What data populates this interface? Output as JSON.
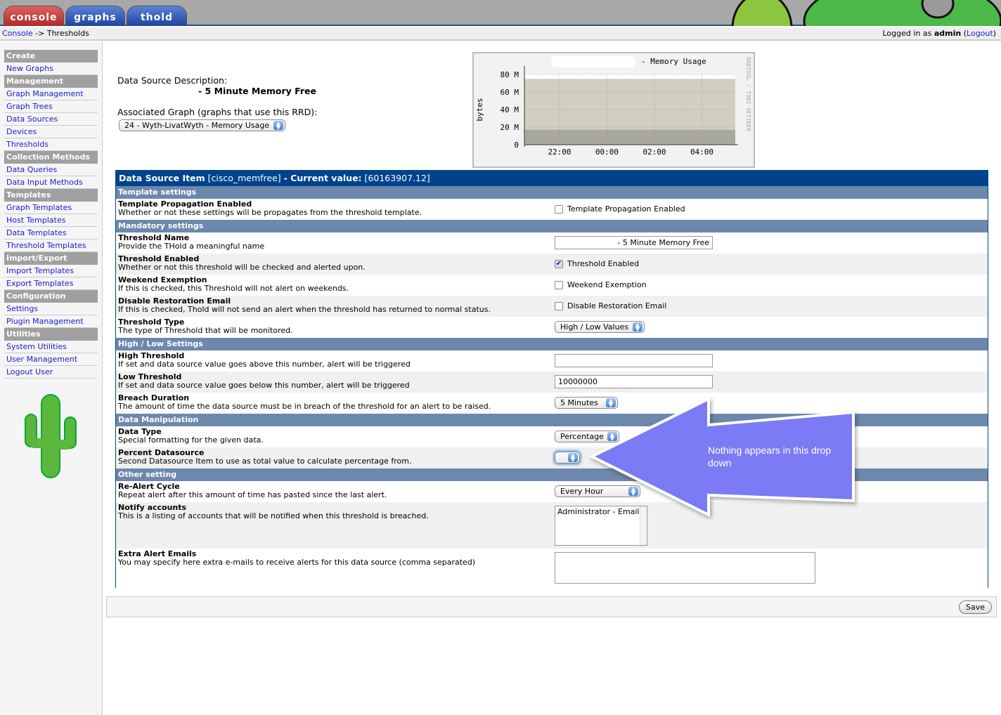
{
  "tabs": [
    {
      "label": "console",
      "color": "#c0393a"
    },
    {
      "label": "graphs",
      "color": "#2b55b0"
    },
    {
      "label": "thold",
      "color": "#2b55b0"
    }
  ],
  "breadcrumb": {
    "root": "Console",
    "sep": "->",
    "current": "Thresholds"
  },
  "login": {
    "prefix": "Logged in as",
    "user": "admin",
    "logout": "Logout"
  },
  "sidebar": [
    {
      "type": "head",
      "label": "Create"
    },
    {
      "type": "item",
      "label": "New Graphs"
    },
    {
      "type": "head",
      "label": "Management"
    },
    {
      "type": "item",
      "label": "Graph Management"
    },
    {
      "type": "item",
      "label": "Graph Trees"
    },
    {
      "type": "item",
      "label": "Data Sources"
    },
    {
      "type": "item",
      "label": "Devices"
    },
    {
      "type": "item",
      "label": "Thresholds"
    },
    {
      "type": "head",
      "label": "Collection Methods"
    },
    {
      "type": "item",
      "label": "Data Queries"
    },
    {
      "type": "item",
      "label": "Data Input Methods"
    },
    {
      "type": "head",
      "label": "Templates"
    },
    {
      "type": "item",
      "label": "Graph Templates"
    },
    {
      "type": "item",
      "label": "Host Templates"
    },
    {
      "type": "item",
      "label": "Data Templates"
    },
    {
      "type": "item",
      "label": "Threshold Templates"
    },
    {
      "type": "head",
      "label": "Import/Export"
    },
    {
      "type": "item",
      "label": "Import Templates"
    },
    {
      "type": "item",
      "label": "Export Templates"
    },
    {
      "type": "head",
      "label": "Configuration"
    },
    {
      "type": "item",
      "label": "Settings"
    },
    {
      "type": "item",
      "label": "Plugin Management"
    },
    {
      "type": "head",
      "label": "Utilities"
    },
    {
      "type": "item",
      "label": "System Utilities"
    },
    {
      "type": "item",
      "label": "User Management"
    },
    {
      "type": "item",
      "label": "Logout User"
    }
  ],
  "ds": {
    "desc_label": "Data Source Description:",
    "desc_value": "- 5 Minute Memory Free",
    "assoc_label": "Associated Graph (graphs that use this RRD):",
    "assoc_value": "24 - Wyth-LivatWyth - Memory Usage"
  },
  "chart_data": {
    "type": "area",
    "title": "- Memory Usage",
    "ylabel": "bytes",
    "watermark": "RRDTOOL / TOBI OETIKER",
    "ylim": [
      0,
      80
    ],
    "yunit": "M",
    "yticks": [
      "0",
      "20 M",
      "40 M",
      "60 M",
      "80 M"
    ],
    "xticks": [
      "22:00",
      "00:00",
      "02:00",
      "04:00"
    ],
    "grid": true,
    "series": [
      {
        "values": [
          17,
          17,
          17,
          17,
          17,
          17
        ],
        "color": "#a8a89c"
      },
      {
        "values": [
          75,
          75,
          75,
          75,
          75,
          75
        ],
        "color": "#cfcfc2"
      }
    ]
  },
  "form": {
    "header": {
      "bold1": "Data Source Item",
      "name": "[cisco_memfree]",
      "bold2": "- Current value:",
      "value": "[60163907.12]"
    },
    "rows": [
      {
        "type": "sec",
        "label": "Template settings"
      },
      {
        "type": "fld",
        "title": "Template Propagation Enabled",
        "desc": "Whether or not these settings will be propagates from the threshold template.",
        "ctrl": "checkbox",
        "checked": false,
        "label": "Template Propagation Enabled"
      },
      {
        "type": "sec",
        "label": "Mandatory settings"
      },
      {
        "type": "fld",
        "title": "Threshold Name",
        "desc": "Provide the THold a meaningful name",
        "ctrl": "text",
        "value": "- 5 Minute Memory Free",
        "align": "right"
      },
      {
        "type": "fld",
        "title": "Threshold Enabled",
        "desc": "Whether or not this threshold will be checked and alerted upon.",
        "ctrl": "checkbox",
        "checked": true,
        "label": "Threshold Enabled"
      },
      {
        "type": "fld",
        "title": "Weekend Exemption",
        "desc": "If this is checked, this Threshold will not alert on weekends.",
        "ctrl": "checkbox",
        "checked": false,
        "label": "Weekend Exemption"
      },
      {
        "type": "fld",
        "title": "Disable Restoration Email",
        "desc": "If this is checked, Thold will not send an alert when the threshold has returned to normal status.",
        "ctrl": "checkbox",
        "checked": false,
        "label": "Disable Restoration Email"
      },
      {
        "type": "fld",
        "title": "Threshold Type",
        "desc": "The type of Threshold that will be monitored.",
        "ctrl": "select",
        "value": "High / Low Values",
        "w": 128
      },
      {
        "type": "sec",
        "label": "High / Low Settings"
      },
      {
        "type": "fld",
        "title": "High Threshold",
        "desc": "If set and data source value goes above this number, alert will be triggered",
        "ctrl": "text",
        "value": ""
      },
      {
        "type": "fld",
        "title": "Low Threshold",
        "desc": "If set and data source value goes below this number, alert will be triggered",
        "ctrl": "text",
        "value": "10000000"
      },
      {
        "type": "fld",
        "title": "Breach Duration",
        "desc": "The amount of time the data source must be in breach of the threshold for an alert to be raised.",
        "ctrl": "select",
        "value": "5 Minutes",
        "w": 90
      },
      {
        "type": "sec",
        "label": "Data Manipulation"
      },
      {
        "type": "fld",
        "title": "Data Type",
        "desc": "Special formatting for the given data.",
        "ctrl": "select",
        "value": "Percentage",
        "w": 92
      },
      {
        "type": "fld",
        "title": "Percent Datasource",
        "desc": "Second Datasource Item to use as total value to calculate percentage from.",
        "ctrl": "select",
        "value": "",
        "w": 36
      },
      {
        "type": "sec",
        "label": "Other setting"
      },
      {
        "type": "fld",
        "title": "Re-Alert Cycle",
        "desc": "Repeat alert after this amount of time has pasted since the last alert.",
        "ctrl": "select",
        "value": "Every Hour",
        "w": 122
      },
      {
        "type": "fld",
        "title": "Notify accounts",
        "desc": "This is a listing of accounts that will be notified when this threshold is breached.",
        "ctrl": "list",
        "value": "Administrator - Email",
        "h": 66
      },
      {
        "type": "fld",
        "title": "Extra Alert Emails",
        "desc": "You may specify here extra e-mails to receive alerts for this data source (comma separated)",
        "ctrl": "textarea",
        "value": "",
        "h": 56
      }
    ]
  },
  "save_label": "Save",
  "callout": {
    "text": "Nothing appears in this drop down",
    "color": "#7b7bf5"
  }
}
